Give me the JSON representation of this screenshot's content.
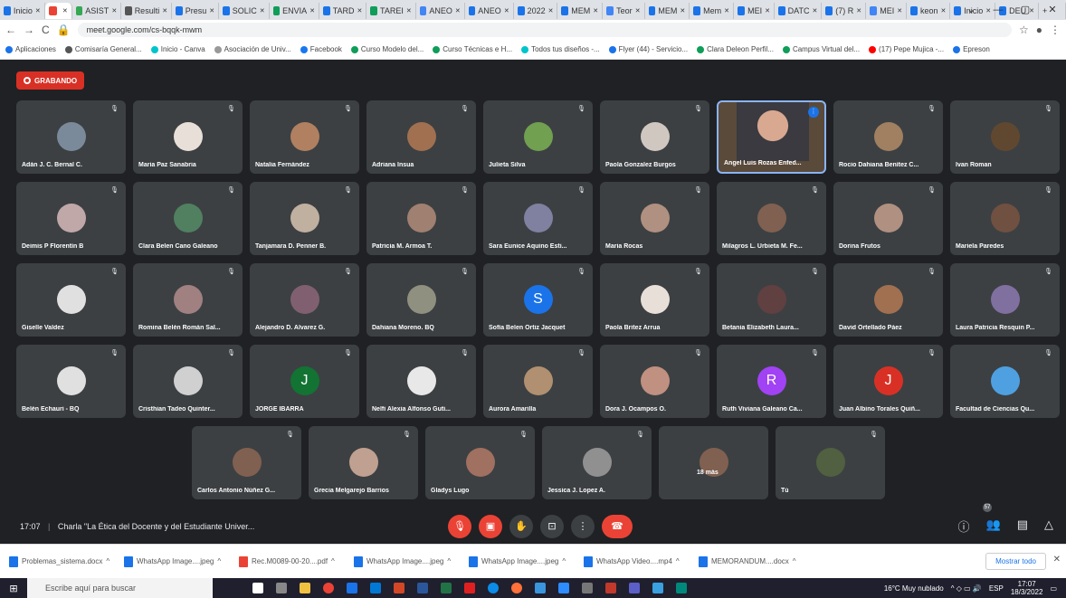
{
  "browser": {
    "tabs": [
      {
        "label": "Inicio",
        "color": "#1a73e8"
      },
      {
        "label": "",
        "color": "#ea4335",
        "active": true
      },
      {
        "label": "ASIST",
        "color": "#34a853"
      },
      {
        "label": "Resulti",
        "color": "#555"
      },
      {
        "label": "Presu",
        "color": "#1a73e8"
      },
      {
        "label": "SOLIC",
        "color": "#1a73e8"
      },
      {
        "label": "ENVIA",
        "color": "#0f9d58"
      },
      {
        "label": "TARD",
        "color": "#1a73e8"
      },
      {
        "label": "TAREI",
        "color": "#0f9d58"
      },
      {
        "label": "ANEO",
        "color": "#4285f4"
      },
      {
        "label": "ANEO",
        "color": "#1a73e8"
      },
      {
        "label": "2022",
        "color": "#1a73e8"
      },
      {
        "label": "MEM",
        "color": "#1a73e8"
      },
      {
        "label": "Teor",
        "color": "#4285f4"
      },
      {
        "label": "MEM",
        "color": "#1a73e8"
      },
      {
        "label": "Mem",
        "color": "#1a73e8"
      },
      {
        "label": "MEI",
        "color": "#1a73e8"
      },
      {
        "label": "DATC",
        "color": "#1a73e8"
      },
      {
        "label": "(7) R",
        "color": "#1a73e8"
      },
      {
        "label": "MEI",
        "color": "#4285f4"
      },
      {
        "label": "keon",
        "color": "#1a73e8"
      },
      {
        "label": "Inicio",
        "color": "#1a73e8"
      },
      {
        "label": "DEU",
        "color": "#1a73e8"
      }
    ],
    "new_tab": "+",
    "window_controls": [
      "⌄",
      "—",
      "▢",
      "✕"
    ],
    "url": "meet.google.com/cs-bqqk-mwm",
    "bookmarks": [
      {
        "label": "Aplicaciones",
        "color": "#1a73e8"
      },
      {
        "label": "Comisaría General...",
        "color": "#555"
      },
      {
        "label": "Inicio - Canva",
        "color": "#00c4cc"
      },
      {
        "label": "Asociación de Univ...",
        "color": "#999"
      },
      {
        "label": "Facebook",
        "color": "#1877f2"
      },
      {
        "label": "Curso Modelo del...",
        "color": "#0f9d58"
      },
      {
        "label": "Curso Técnicas e H...",
        "color": "#0f9d58"
      },
      {
        "label": "Todos tus diseños -...",
        "color": "#00c4cc"
      },
      {
        "label": "Flyer (44) - Servicio...",
        "color": "#1a73e8"
      },
      {
        "label": "Clara Deleon Perfil...",
        "color": "#0f9d58"
      },
      {
        "label": "Campus Virtual del...",
        "color": "#0f9d58"
      },
      {
        "label": "(17) Pepe Mujica -...",
        "color": "#ff0000"
      },
      {
        "label": "Epreson",
        "color": "#1a73e8"
      }
    ]
  },
  "meet": {
    "recording_label": "GRABANDO",
    "participants": [
      {
        "name": "Adán J. C. Bernal C.",
        "avatar": "photo",
        "color": "#7a8a9a"
      },
      {
        "name": "Maria Paz Sanabria",
        "avatar": "photo",
        "color": "#e8e0d8"
      },
      {
        "name": "Natalia Fernández",
        "avatar": "photo",
        "color": "#b08060"
      },
      {
        "name": "Adriana Insua",
        "avatar": "photo",
        "color": "#a07050"
      },
      {
        "name": "Julieta Silva",
        "avatar": "photo",
        "color": "#70a050"
      },
      {
        "name": "Paola Gonzalez Burgos",
        "avatar": "photo",
        "color": "#d0c8c0"
      },
      {
        "name": "Angel Luis Rozas Enfed...",
        "avatar": "speaker",
        "color": "#c09070"
      },
      {
        "name": "Rocio Dahiana Benítez C...",
        "avatar": "photo",
        "color": "#a08060"
      },
      {
        "name": "Ivan Roman",
        "avatar": "photo",
        "color": "#604830"
      },
      {
        "name": "Deimis P Florentín B",
        "avatar": "photo",
        "color": "#c0a8a8"
      },
      {
        "name": "Clara Belen Cano Galeano",
        "avatar": "photo",
        "color": "#508060"
      },
      {
        "name": "Tanjamara D. Penner B.",
        "avatar": "photo",
        "color": "#c0b0a0"
      },
      {
        "name": "Patricia M. Armoa T.",
        "avatar": "photo",
        "color": "#a08070"
      },
      {
        "name": "Sara Eunice Aquino Esti...",
        "avatar": "photo",
        "color": "#8080a0"
      },
      {
        "name": "Maria Rocas",
        "avatar": "photo",
        "color": "#b09080"
      },
      {
        "name": "Milagros L. Urbieta M. Fe...",
        "avatar": "photo",
        "color": "#806050"
      },
      {
        "name": "Dorina Frutos",
        "avatar": "photo",
        "color": "#b09080"
      },
      {
        "name": "Mariela Paredes",
        "avatar": "photo",
        "color": "#705040"
      },
      {
        "name": "Giselle Valdez",
        "avatar": "photo",
        "color": "#e0e0e0"
      },
      {
        "name": "Romina Belén Román Sal...",
        "avatar": "photo",
        "color": "#a08080"
      },
      {
        "name": "Alejandro D. Alvarez G.",
        "avatar": "photo",
        "color": "#806070"
      },
      {
        "name": "Dahiana Moreno. BQ",
        "avatar": "photo",
        "color": "#909080"
      },
      {
        "name": "Sofía Belen Ortiz Jacquet",
        "avatar": "S",
        "color": "#1a73e8"
      },
      {
        "name": "Paola Britez Arrua",
        "avatar": "photo",
        "color": "#e8e0d8"
      },
      {
        "name": "Betania Elizabeth Laura...",
        "avatar": "photo",
        "color": "#604040"
      },
      {
        "name": "David Ortellado Páez",
        "avatar": "photo",
        "color": "#a07050"
      },
      {
        "name": "Laura Patricia Resquin P...",
        "avatar": "photo",
        "color": "#8070a0"
      },
      {
        "name": "Belén Echauri - BQ",
        "avatar": "photo",
        "color": "#e0e0e0"
      },
      {
        "name": "Cristhian Tadeo Quinter...",
        "avatar": "photo",
        "color": "#d0d0d0"
      },
      {
        "name": "JORGE IBARRA",
        "avatar": "J",
        "color": "#137333"
      },
      {
        "name": "Nelfi Alexia Alfonso Guti...",
        "avatar": "photo",
        "color": "#e8e8e8"
      },
      {
        "name": "Aurora Amarilla",
        "avatar": "photo",
        "color": "#b09070"
      },
      {
        "name": "Dora J. Ocampos O.",
        "avatar": "photo",
        "color": "#c09080"
      },
      {
        "name": "Ruth Viviana Galeano Ca...",
        "avatar": "R",
        "color": "#a142f4"
      },
      {
        "name": "Juan Albino Torales Quiñ...",
        "avatar": "J",
        "color": "#d93025"
      },
      {
        "name": "Facultad de Ciencias Qu...",
        "avatar": "photo",
        "color": "#4fa0e0"
      },
      {
        "name": "Carlos Antonio Núñez G...",
        "avatar": "photo",
        "color": "#806050"
      },
      {
        "name": "Grecia Melgarejo Barrios",
        "avatar": "photo",
        "color": "#c0a090"
      },
      {
        "name": "Gladys Lugo",
        "avatar": "photo",
        "color": "#a07060"
      },
      {
        "name": "Jessica J. Lopez A.",
        "avatar": "photo",
        "color": "#909090"
      },
      {
        "name": "18 más",
        "avatar": "group",
        "color": "#806050"
      },
      {
        "name": "Tú",
        "avatar": "photo",
        "color": "#506040"
      }
    ],
    "time": "17:07",
    "separator": "|",
    "meeting_title": "Charla \"La Ética del Docente y del Estudiante Univer...",
    "participant_count": "57",
    "controls": [
      "mic-off",
      "camera-off",
      "raise-hand",
      "present",
      "more",
      "hang-up"
    ],
    "right_controls": [
      "info",
      "people",
      "chat",
      "activities"
    ]
  },
  "downloads": {
    "items": [
      {
        "label": "Problemas_sistema.docx",
        "color": "#1a73e8"
      },
      {
        "label": "WhatsApp Image....jpeg",
        "color": "#1a73e8"
      },
      {
        "label": "Rec.M0089-00-20....pdf",
        "color": "#ea4335"
      },
      {
        "label": "WhatsApp Image....jpeg",
        "color": "#1a73e8"
      },
      {
        "label": "WhatsApp Image....jpeg",
        "color": "#1a73e8"
      },
      {
        "label": "WhatsApp Video....mp4",
        "color": "#1a73e8"
      },
      {
        "label": "MEMORANDUM....docx",
        "color": "#1a73e8"
      }
    ],
    "show_all": "Mostrar todo",
    "close": "✕"
  },
  "taskbar": {
    "search_placeholder": "Escribe aquí para buscar",
    "weather": "16°C Muy nublado",
    "lang": "ESP",
    "clock_time": "17:07",
    "clock_date": "18/3/2022"
  }
}
